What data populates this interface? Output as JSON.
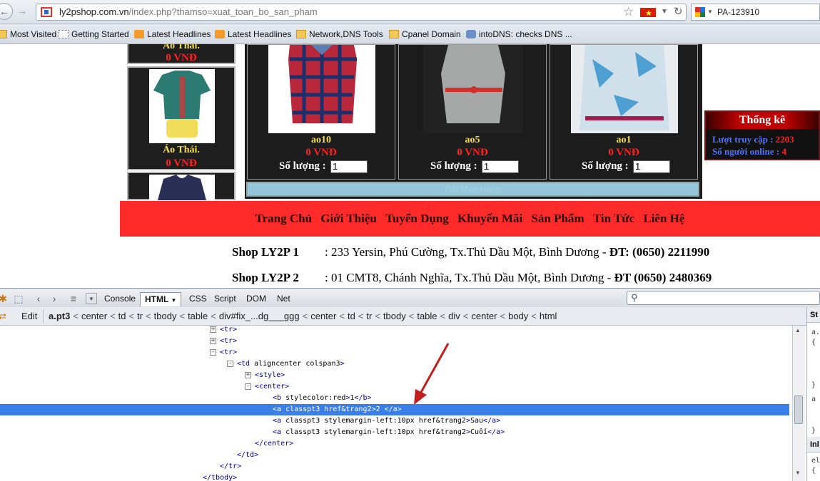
{
  "browser": {
    "url_host": "ly2pshop.com.vn",
    "url_path": "/index.php?thamso=xuat_toan_bo_san_pham",
    "search_text": "PA-123910",
    "bookmarks": [
      "Most Visited",
      "Getting Started",
      "Latest Headlines",
      "Latest Headlines",
      "Network,DNS Tools",
      "Cpanel Domain",
      "intoDNS: checks DNS ..."
    ]
  },
  "page": {
    "sidebar": [
      {
        "name": "Áo Thái.",
        "price": "0 VNĐ"
      },
      {
        "name": "Áo Thái.",
        "price": "0 VNĐ"
      }
    ],
    "products": [
      {
        "name": "ao10",
        "price": "0 VNĐ",
        "qty_label": "Số lượng :",
        "qty": "1"
      },
      {
        "name": "ao5",
        "price": "0 VNĐ",
        "qty_label": "Số lượng :",
        "qty": "1"
      },
      {
        "name": "ao1",
        "price": "0 VNĐ",
        "qty_label": "Số lượng :",
        "qty": "1"
      }
    ],
    "order_button": "Đặt Mua Hàng",
    "stats": {
      "title": "Thống kê",
      "visits_label": "Lượt truy cập :",
      "visits": "2203",
      "online_label": "Số người online :",
      "online": "4"
    },
    "menu": [
      "Trang Chủ",
      "Giới Thiệu",
      "Tuyển Dụng",
      "Khuyến Mãi",
      "Sản Phẩm",
      "Tin Tức",
      "Liên Hệ"
    ],
    "shops": [
      {
        "name": "Shop LY2P 1",
        "address": ": 233 Yersin, Phú Cường, Tx.Thủ Dầu Một, Bình Dương - ",
        "phone": "ĐT: (0650) 2211990"
      },
      {
        "name": "Shop LY2P 2",
        "address": ": 01 CMT8, Chánh Nghĩa, Tx.Thủ Dầu Một, Bình Dương - ",
        "phone": "ĐT (0650) 2480369"
      }
    ]
  },
  "firebug": {
    "tabs": [
      "Console",
      "HTML",
      "CSS",
      "Script",
      "DOM",
      "Net"
    ],
    "active_tab": "HTML",
    "edit_label": "Edit",
    "breadcrumbs": [
      "a.pt3",
      "center",
      "td",
      "tr",
      "tbody",
      "table",
      "div#fix_...dg___ggg",
      "center",
      "td",
      "tr",
      "tbody",
      "table",
      "div",
      "center",
      "body",
      "html"
    ],
    "side_labels": [
      "St",
      "a.",
      "{",
      "}",
      "a",
      "}",
      "Inl",
      "el",
      "{"
    ],
    "html_lines": [
      {
        "text": "<tr>",
        "twisty": "+"
      },
      {
        "text": "<tr>",
        "twisty": "+"
      },
      {
        "text": "<tr>",
        "twisty": "-"
      },
      {
        "text": "<td align=\"center\" colspan=\"3\">",
        "twisty": "-"
      },
      {
        "text": "<style>",
        "twisty": "+"
      },
      {
        "text": "<center>",
        "twisty": "-"
      },
      {
        "text": "<b style=\"color:red\">1</b>",
        "twisty": ""
      },
      {
        "text": "<a class=\"pt3\" href=\"&trang=2\">2 </a>",
        "twisty": ""
      },
      {
        "text": "<a class=\"pt3\" style=\"margin-left:10px\" href=\"&trang=2\">Sau</a>",
        "twisty": ""
      },
      {
        "text": "<a class=\"pt3\" style=\"margin-left:10px\" href=\"&trang=2\">Cuối</a>",
        "twisty": ""
      },
      {
        "text": "</center>",
        "twisty": ""
      },
      {
        "text": "</td>",
        "twisty": ""
      },
      {
        "text": "</tr>",
        "twisty": ""
      },
      {
        "text": "</tbody>",
        "twisty": ""
      }
    ]
  }
}
